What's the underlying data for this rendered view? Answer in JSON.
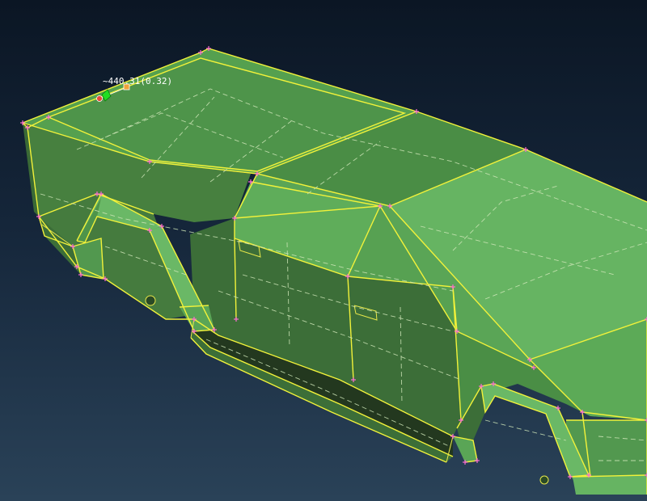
{
  "viewport": {
    "measurement_readout": "~440.31(0.32)",
    "colors": {
      "background_top": "#0b1624",
      "background_bottom": "#2a4258",
      "face_light": "#66b462",
      "face_mid": "#52984f",
      "face_dark": "#3c6e38",
      "face_darkest": "#23381f",
      "edge": "#f2f23a",
      "vertex_marker": "#ff6ad5",
      "gizmo_green": "#22dd22",
      "gizmo_red": "#e84a3a",
      "gizmo_orange": "#f0a23a"
    },
    "icons": {
      "vertex_markers": "plus-marker-icon",
      "measure_gizmo": "measure-handle-icon"
    }
  }
}
